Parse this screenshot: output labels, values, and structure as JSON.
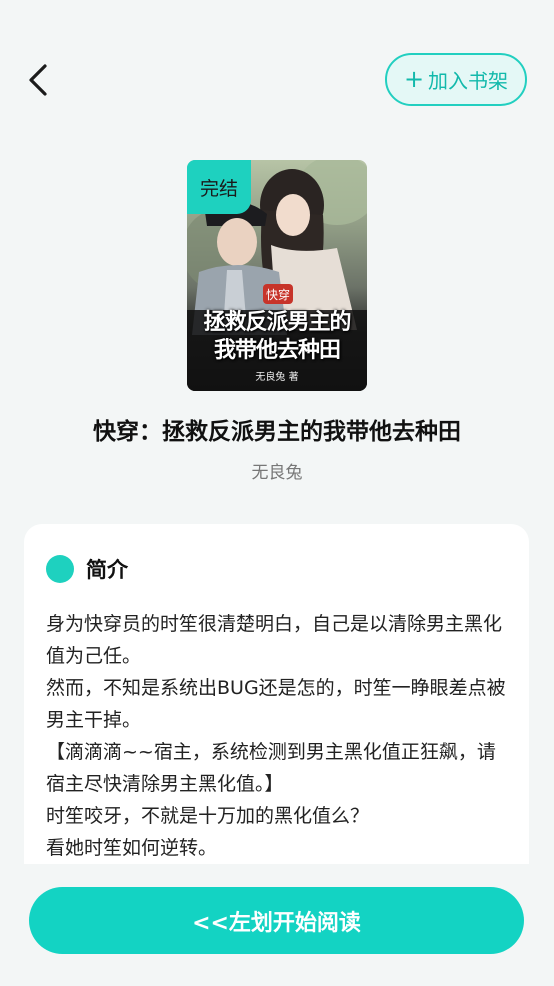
{
  "header": {
    "back_icon": "chevron-left-icon",
    "add_shelf_icon": "plus-icon",
    "add_shelf_label": "加入书架"
  },
  "cover": {
    "status_badge": "完结",
    "genre_tag": "快穿",
    "title": "拯救反派男主的我带他去种田",
    "author_line": "无良兔 著"
  },
  "book": {
    "title": "快穿：拯救反派男主的我带他去种田",
    "author": "无良兔"
  },
  "intro": {
    "heading": "简介",
    "paragraphs": [
      "身为快穿员的时笙很清楚明白，自己是以清除男主黑化值为己任。",
      "然而，不知是系统出BUG还是怎的，时笙一睁眼差点被男主干掉。",
      "【滴滴滴~~宿主，系统检测到男主黑化值正狂飙，请宿主尽快清除男主黑化值。】",
      "时笙咬牙，不就是十万加的黑化值么？",
      "看她时笙如何逆转。"
    ]
  },
  "footer": {
    "start_label": "<<左划开始阅读"
  },
  "colors": {
    "accent": "#13d3c3",
    "background": "#f3f6f6",
    "card": "#ffffff"
  }
}
